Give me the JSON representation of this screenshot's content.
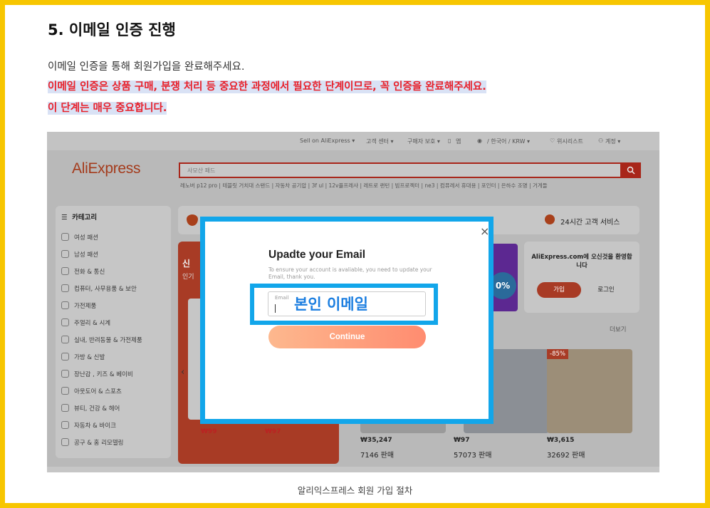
{
  "article": {
    "heading": "5. 이메일 인증 진행",
    "intro": "이메일 인증을 통해 회원가입을 완료해주세요.",
    "highlight_line1": "이메일 인증은 상품 구매, 분쟁 처리 등 중요한 과정에서 필요한 단계이므로, 꼭 인증을 완료해주세요.",
    "highlight_line2": "이 단계는 매우 중요합니다.",
    "caption": "알리익스프레스 회원 가입 절차"
  },
  "colors": {
    "frame": "#f7c600",
    "highlight_text": "#e8202a",
    "highlight_bg": "#d9e2f5",
    "annotation": "#12a6ea",
    "annotation_text": "#1b7ee0"
  },
  "site": {
    "topbar": {
      "sell": "Sell on AliExpress ▾",
      "service": "고객 센터 ▾",
      "buyer_protection": "구매자 보호 ▾",
      "app": "앱",
      "locale": "/ 한국어 / KRW ▾",
      "wishlist": "위시리스트",
      "account": "계정 ▾"
    },
    "logo": "AliExpress",
    "search_placeholder": "사모산 패드",
    "hot_searches": "레노버 p12 pro  |  테블릿 거치대 스탠드  |  자동차 공기압  |  3f ul  |  12v플프레샤  |  레트로 랜턴  |  빔프로젝터  |  ne3  |  컴퓨레서 휴대용  |  포인터  |  은하수 조명  |  거게들",
    "sidebar": {
      "title": "카테고리",
      "items": [
        "여성 패션",
        "남성 패션",
        "전화 & 통신",
        "컴퓨터, 사무용품 & 보안",
        "가전제품",
        "주얼리 & 시계",
        "실내, 반려동물 & 가전제품",
        "가방 & 신발",
        "장난감 , 키즈 & 베이비",
        "아웃도어 & 스포츠",
        "뷰티, 건강 & 헤어",
        "자동차 & 바이크",
        "공구 & 홈 리모델링"
      ]
    },
    "customer_service": "24시간 고객 서비스",
    "banner_left": {
      "title": "신",
      "sub": "인기",
      "prices": [
        "₩99",
        "₩97"
      ]
    },
    "promo_badge": "0%",
    "account_card": {
      "welcome": "AliExpress.com에 오신것을 환영합니다",
      "join": "가입",
      "login": "로그인"
    },
    "more": "더보기",
    "discount": "-85%",
    "products": [
      {
        "price": "₩35,247",
        "sold": "7146 판매"
      },
      {
        "price": "₩97",
        "sold": "57073 판매"
      },
      {
        "price": "₩3,615",
        "sold": "32692 판매"
      }
    ]
  },
  "modal": {
    "close": "×",
    "title": "Upadte your Email",
    "description": "To ensure your account is avaliable, you need to update your Email, thank you.",
    "email_label": "Email",
    "email_annotation": "본인 이메일",
    "continue": "Continue"
  }
}
